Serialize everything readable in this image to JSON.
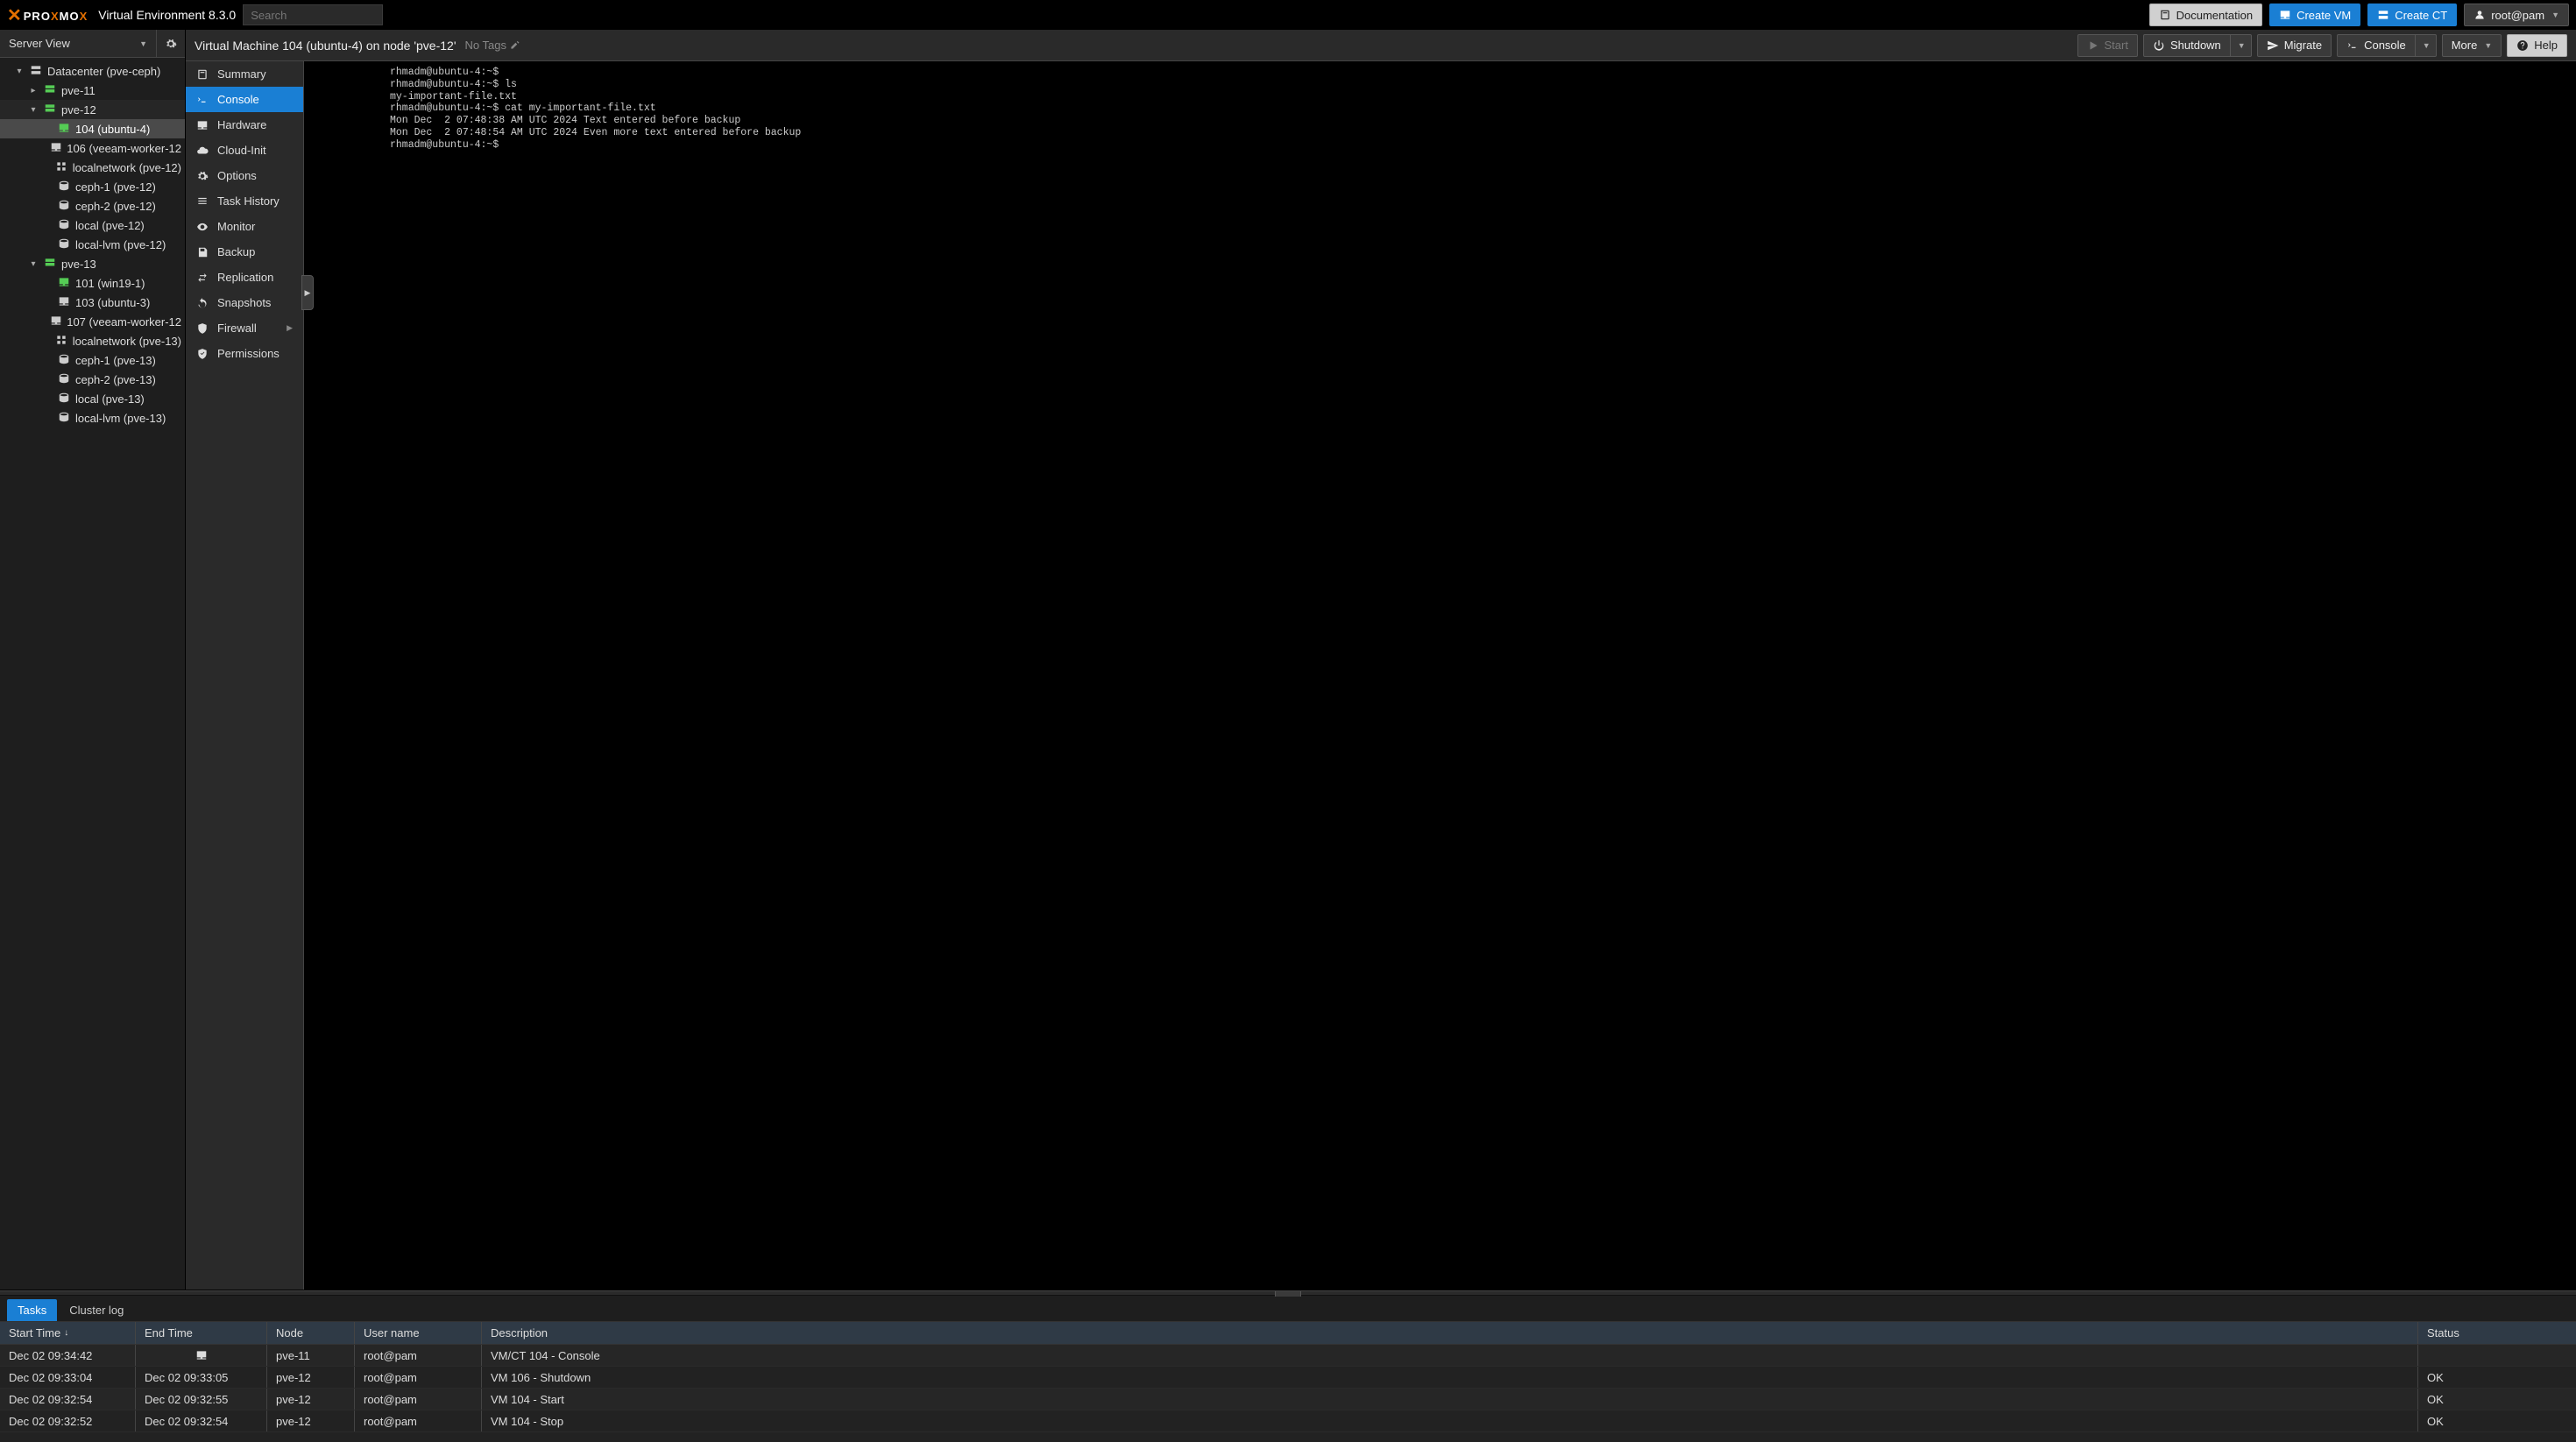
{
  "header": {
    "logo_prefix": "PRO",
    "logo_mid": "X",
    "logo_suffix": "MO",
    "logo_end": "X",
    "ve_title": "Virtual Environment 8.3.0",
    "search_placeholder": "Search",
    "doc_label": "Documentation",
    "create_vm_label": "Create VM",
    "create_ct_label": "Create CT",
    "user_label": "root@pam"
  },
  "left": {
    "view_label": "Server View",
    "tree": [
      {
        "indent": 0,
        "tog": "▾",
        "icon": "server",
        "label": "Datacenter (pve-ceph)",
        "sel": false
      },
      {
        "indent": 1,
        "tog": "▸",
        "icon": "node",
        "label": "pve-11",
        "sel": false
      },
      {
        "indent": 1,
        "tog": "▾",
        "icon": "node",
        "label": "pve-12",
        "sel": false,
        "hov": true
      },
      {
        "indent": 2,
        "tog": "",
        "icon": "vm-on",
        "label": "104 (ubuntu-4)",
        "sel": true
      },
      {
        "indent": 2,
        "tog": "",
        "icon": "vm",
        "label": "106 (veeam-worker-12",
        "sel": false
      },
      {
        "indent": 2,
        "tog": "",
        "icon": "net",
        "label": "localnetwork (pve-12)",
        "sel": false
      },
      {
        "indent": 2,
        "tog": "",
        "icon": "disk",
        "label": "ceph-1 (pve-12)",
        "sel": false
      },
      {
        "indent": 2,
        "tog": "",
        "icon": "disk",
        "label": "ceph-2 (pve-12)",
        "sel": false
      },
      {
        "indent": 2,
        "tog": "",
        "icon": "disk",
        "label": "local (pve-12)",
        "sel": false
      },
      {
        "indent": 2,
        "tog": "",
        "icon": "disk",
        "label": "local-lvm (pve-12)",
        "sel": false
      },
      {
        "indent": 1,
        "tog": "▾",
        "icon": "node",
        "label": "pve-13",
        "sel": false
      },
      {
        "indent": 2,
        "tog": "",
        "icon": "vm-on",
        "label": "101 (win19-1)",
        "sel": false
      },
      {
        "indent": 2,
        "tog": "",
        "icon": "vm",
        "label": "103 (ubuntu-3)",
        "sel": false
      },
      {
        "indent": 2,
        "tog": "",
        "icon": "vm",
        "label": "107 (veeam-worker-12",
        "sel": false
      },
      {
        "indent": 2,
        "tog": "",
        "icon": "net",
        "label": "localnetwork (pve-13)",
        "sel": false
      },
      {
        "indent": 2,
        "tog": "",
        "icon": "disk",
        "label": "ceph-1 (pve-13)",
        "sel": false
      },
      {
        "indent": 2,
        "tog": "",
        "icon": "disk",
        "label": "ceph-2 (pve-13)",
        "sel": false
      },
      {
        "indent": 2,
        "tog": "",
        "icon": "disk",
        "label": "local (pve-13)",
        "sel": false
      },
      {
        "indent": 2,
        "tog": "",
        "icon": "disk",
        "label": "local-lvm (pve-13)",
        "sel": false
      }
    ]
  },
  "content": {
    "title": "Virtual Machine 104 (ubuntu-4) on node 'pve-12'",
    "no_tags": "No Tags",
    "actions": {
      "start": "Start",
      "shutdown": "Shutdown",
      "migrate": "Migrate",
      "console": "Console",
      "more": "More",
      "help": "Help"
    },
    "subnav": [
      {
        "icon": "book",
        "label": "Summary",
        "sel": false
      },
      {
        "icon": "term",
        "label": "Console",
        "sel": true
      },
      {
        "icon": "monitor",
        "label": "Hardware",
        "sel": false
      },
      {
        "icon": "cloud",
        "label": "Cloud-Init",
        "sel": false
      },
      {
        "icon": "gear",
        "label": "Options",
        "sel": false
      },
      {
        "icon": "list",
        "label": "Task History",
        "sel": false
      },
      {
        "icon": "eye",
        "label": "Monitor",
        "sel": false
      },
      {
        "icon": "floppy",
        "label": "Backup",
        "sel": false
      },
      {
        "icon": "repl",
        "label": "Replication",
        "sel": false
      },
      {
        "icon": "undo",
        "label": "Snapshots",
        "sel": false
      },
      {
        "icon": "shield",
        "label": "Firewall",
        "sel": false,
        "arrow": true
      },
      {
        "icon": "perm",
        "label": "Permissions",
        "sel": false
      }
    ],
    "console_lines": [
      "rhmadm@ubuntu-4:~$",
      "rhmadm@ubuntu-4:~$ ls",
      "my-important-file.txt",
      "rhmadm@ubuntu-4:~$ cat my-important-file.txt",
      "Mon Dec  2 07:48:38 AM UTC 2024 Text entered before backup",
      "Mon Dec  2 07:48:54 AM UTC 2024 Even more text entered before backup",
      "rhmadm@ubuntu-4:~$"
    ]
  },
  "bottom": {
    "tabs": {
      "tasks": "Tasks",
      "cluster_log": "Cluster log"
    },
    "columns": {
      "start": "Start Time",
      "end": "End Time",
      "node": "Node",
      "user": "User name",
      "desc": "Description",
      "status": "Status"
    },
    "rows": [
      {
        "start": "Dec 02 09:34:42",
        "end_icon": true,
        "end": "",
        "node": "pve-11",
        "user": "root@pam",
        "desc": "VM/CT 104 - Console",
        "status": ""
      },
      {
        "start": "Dec 02 09:33:04",
        "end": "Dec 02 09:33:05",
        "node": "pve-12",
        "user": "root@pam",
        "desc": "VM 106 - Shutdown",
        "status": "OK"
      },
      {
        "start": "Dec 02 09:32:54",
        "end": "Dec 02 09:32:55",
        "node": "pve-12",
        "user": "root@pam",
        "desc": "VM 104 - Start",
        "status": "OK"
      },
      {
        "start": "Dec 02 09:32:52",
        "end": "Dec 02 09:32:54",
        "node": "pve-12",
        "user": "root@pam",
        "desc": "VM 104 - Stop",
        "status": "OK"
      }
    ]
  }
}
